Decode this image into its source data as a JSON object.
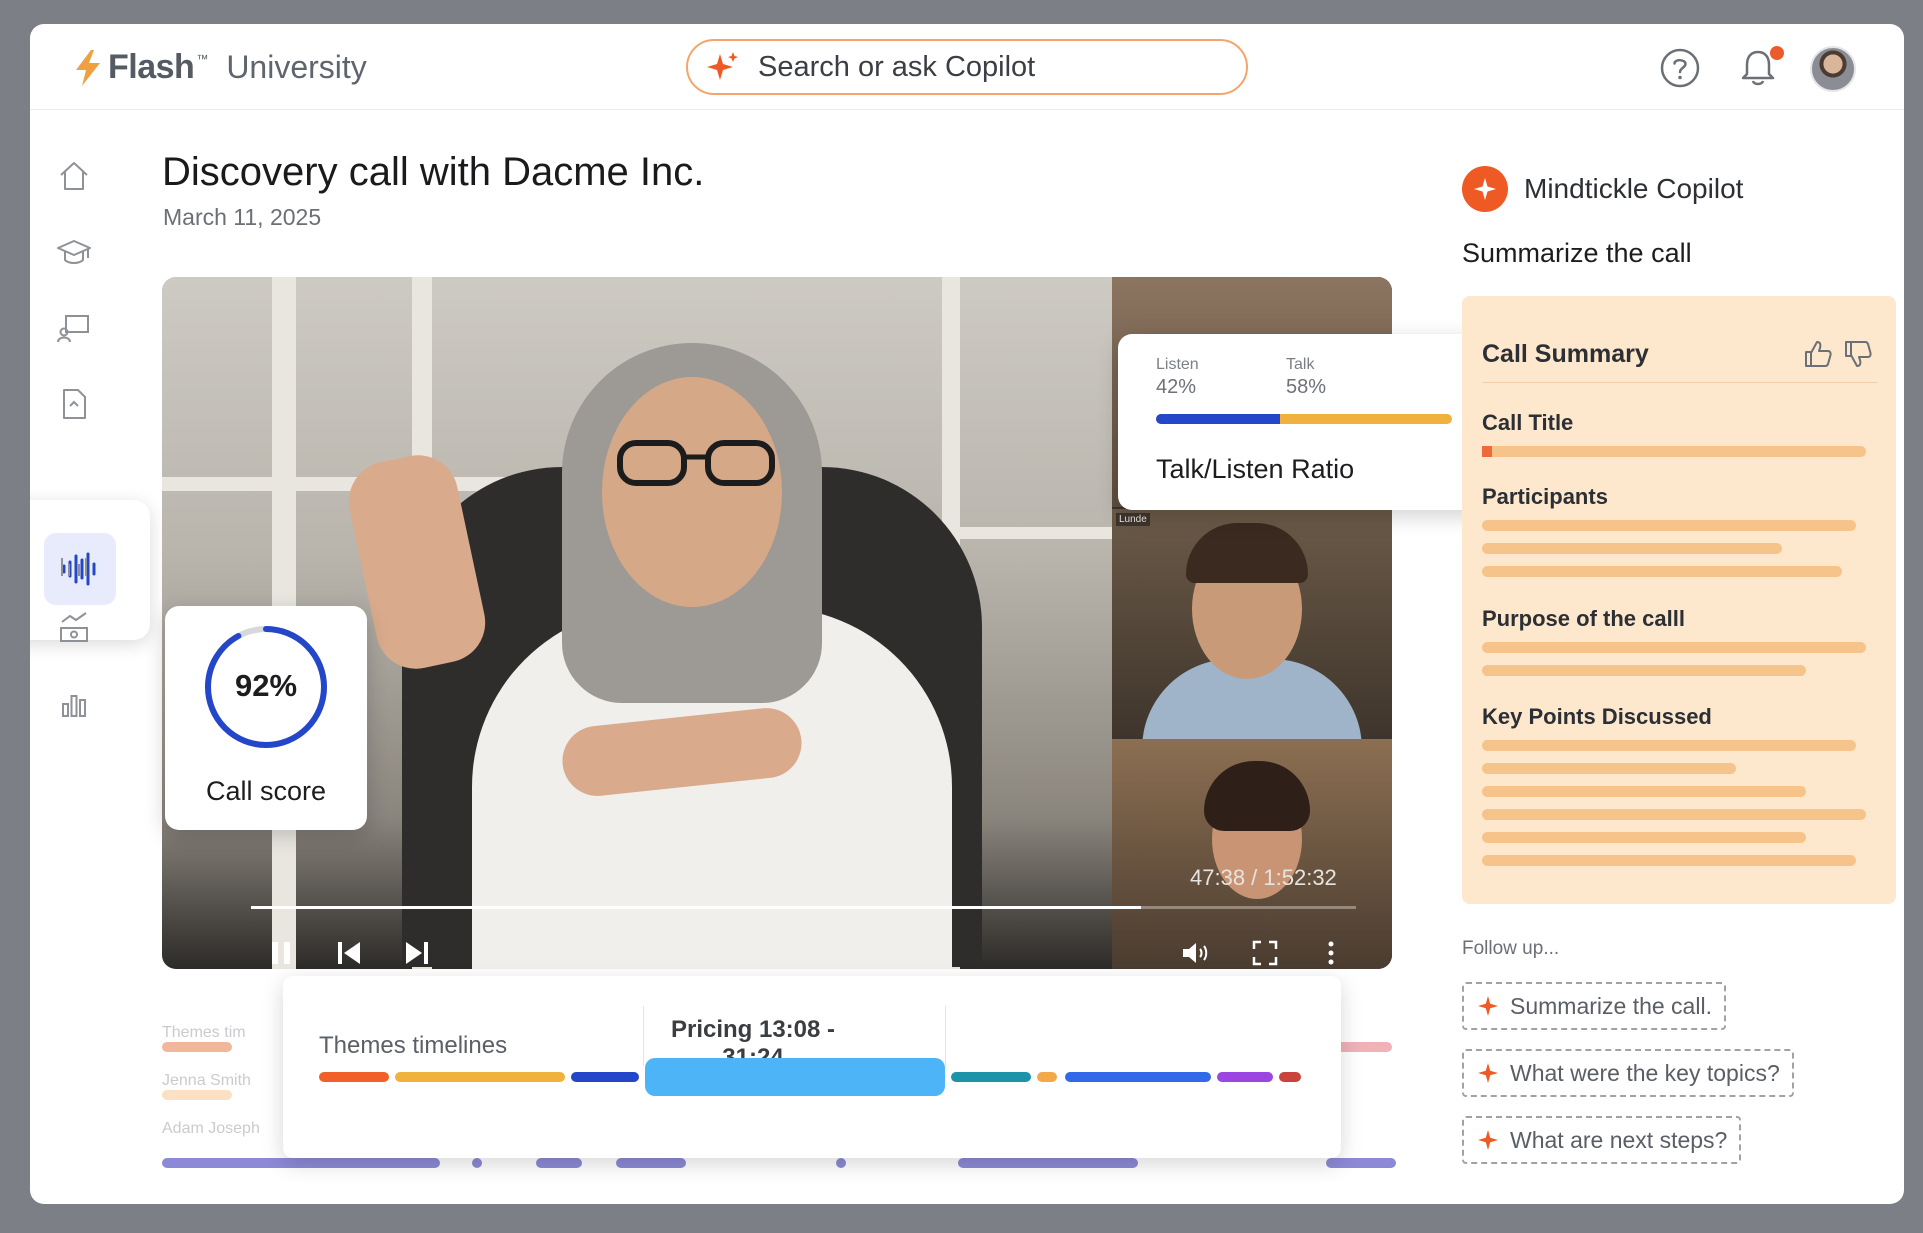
{
  "header": {
    "brand": "Flash",
    "brand_mark": "™",
    "product": "University",
    "search_placeholder": "Search or ask Copilot"
  },
  "page": {
    "title": "Discovery call with Dacme Inc.",
    "date": "March 11, 2025"
  },
  "video": {
    "timecode": "47:38 / 1:52:32",
    "progress": 0.805,
    "participant_tag": "Lunde"
  },
  "talk_listen": {
    "listen_label": "Listen",
    "listen_value": "42%",
    "talk_label": "Talk",
    "talk_value": "58%",
    "listen_fraction": 0.42,
    "title": "Talk/Listen Ratio"
  },
  "call_score": {
    "value": "92%",
    "fraction": 0.92,
    "label": "Call score"
  },
  "timeline": {
    "bg_rows": [
      "Themes tim",
      "Jenna Smith",
      "Adam Joseph"
    ],
    "themes_label": "Themes timelines",
    "highlight_label": "Pricing 13:08 - 31:24"
  },
  "copilot": {
    "title": "Mindtickle Copilot",
    "prompt": "Summarize the call",
    "summary": {
      "heading": "Call Summary",
      "sections": [
        "Call Title",
        "Participants",
        "Purpose of the calll",
        "Key Points Discussed"
      ]
    },
    "follow_up_label": "Follow up...",
    "suggestions": [
      "Summarize the call.",
      "What were the key topics?",
      "What are next steps?"
    ]
  },
  "colors": {
    "accent": "#ef5a24",
    "listen": "#2447c9",
    "talk": "#f0b23c",
    "summary_bg": "#fde7cd",
    "pricing": "#4db4f7"
  }
}
